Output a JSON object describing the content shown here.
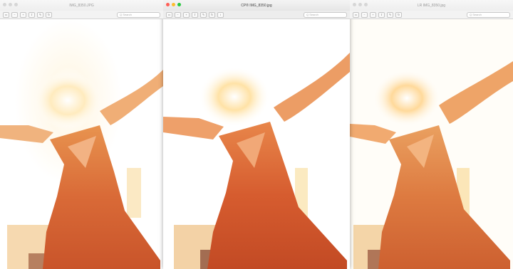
{
  "windows": [
    {
      "title": "IMG_8350.JPG",
      "search_placeholder": "Q Search"
    },
    {
      "title": "CP® IMG_8350.jpg",
      "search_placeholder": "Q Search"
    },
    {
      "title": "LR IMG_8350.jpg",
      "search_placeholder": "Q Search"
    }
  ],
  "colors": {
    "traffic_close": "#ff5f57",
    "traffic_min": "#febc2e",
    "traffic_max": "#28c840"
  }
}
